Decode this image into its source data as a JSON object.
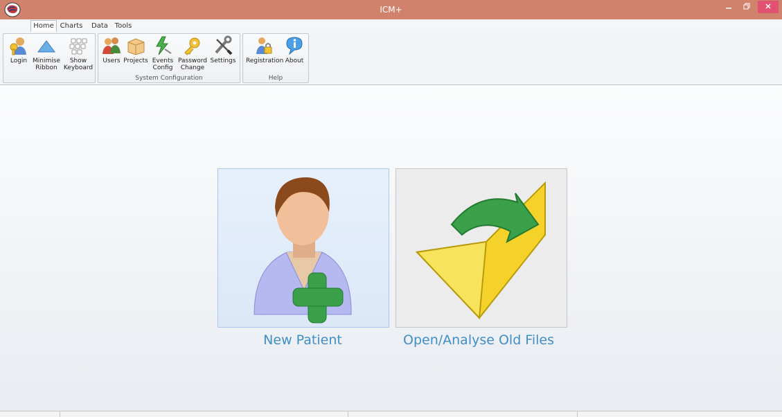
{
  "window": {
    "title": "ICM+",
    "app_icon": "brain-logo-icon",
    "buttons": [
      "minimize-icon",
      "restore-icon",
      "close-icon"
    ]
  },
  "tabs": [
    "Home",
    "Charts",
    "Data",
    "Tools"
  ],
  "active_tab": "Home",
  "ribbon": {
    "groups": [
      {
        "label": "",
        "buttons": [
          {
            "label": "Login",
            "icon": "key-user-icon"
          },
          {
            "label": "Minimise\nRibbon",
            "icon": "triangle-up-icon"
          },
          {
            "label": "Show\nKeyboard",
            "icon": "keyboard-icon"
          }
        ]
      },
      {
        "label": "System Configuration",
        "buttons": [
          {
            "label": "Users",
            "icon": "users-icon"
          },
          {
            "label": "Projects",
            "icon": "projects-box-icon"
          },
          {
            "label": "Events\nConfig",
            "icon": "events-lightning-icon"
          },
          {
            "label": "Password\nChange",
            "icon": "password-key-icon"
          },
          {
            "label": "Settings",
            "icon": "wrench-screwdriver-icon"
          }
        ]
      },
      {
        "label": "Help",
        "buttons": [
          {
            "label": "Registration",
            "icon": "padlock-user-icon"
          },
          {
            "label": "About",
            "icon": "info-bubble-icon"
          }
        ]
      }
    ]
  },
  "main": {
    "new_patient": {
      "caption": "New Patient",
      "icon": "patient-add-icon"
    },
    "open_files": {
      "caption": "Open/Analyse Old Files",
      "icon": "folder-open-arrow-icon"
    }
  },
  "colors": {
    "titlebar": "#d0826c",
    "close_button": "#e0526f",
    "caption_text": "#3f8fc4"
  }
}
